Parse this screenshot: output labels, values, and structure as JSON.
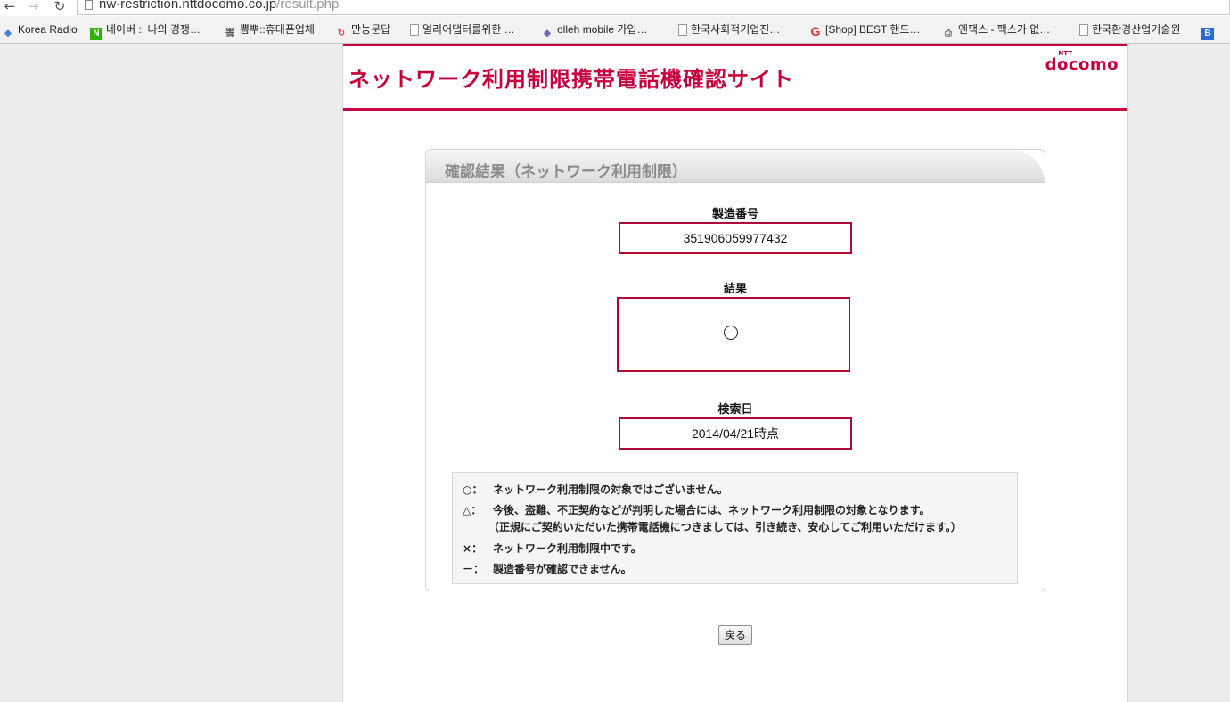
{
  "browser": {
    "url_host": "nw-restriction.nttdocomo.co.jp",
    "url_path": "/result.php",
    "bookmarks": [
      {
        "label": "Korea Radio",
        "icon": "radio-icon"
      },
      {
        "label": "네이버 :: 나의 경쟁…",
        "icon": "naver-icon"
      },
      {
        "label": "뽐뿌::휴대폰업체",
        "icon": "ppomppu-icon"
      },
      {
        "label": "만능문답",
        "icon": "swirl-icon"
      },
      {
        "label": "얼리어댑터를위한 …",
        "icon": "page-icon"
      },
      {
        "label": "olleh mobile 가입…",
        "icon": "diamond-icon"
      },
      {
        "label": "한국사회적기업진…",
        "icon": "page-icon"
      },
      {
        "label": "[Shop] BEST 핸드…",
        "icon": "shop-icon"
      },
      {
        "label": "엔팩스 - 팩스가 없…",
        "icon": "fax-icon"
      },
      {
        "label": "한국환경산업기술원",
        "icon": "page-icon"
      },
      {
        "label": "",
        "icon": "b-icon"
      }
    ]
  },
  "header": {
    "site_title": "ネットワーク利用制限携帯電話機確認サイト",
    "logo_ntt": "NTT",
    "logo_word": "docomo",
    "brand_color": "#c8003c"
  },
  "panel": {
    "title": "確認結果（ネットワーク利用制限）",
    "serial_label": "製造番号",
    "serial_value": "351906059977432",
    "result_label": "結果",
    "result_value": "○",
    "date_label": "検索日",
    "date_value": "2014/04/21時点"
  },
  "legend": {
    "circle_sym": "○",
    "circle_text": "ネットワーク利用制限の対象ではございません。",
    "triangle_sym": "△",
    "triangle_text": "今後、盗難、不正契約などが判明した場合には、ネットワーク利用制限の対象となります。",
    "triangle_sub": "（正規にご契約いただいた携帯電話機につきましては、引き続き、安心してご利用いただけます。）",
    "cross_sym": "×",
    "cross_text": "ネットワーク利用制限中です。",
    "dash_sym": "－",
    "dash_text": "製造番号が確認できません。",
    "separator": "："
  },
  "actions": {
    "back_label": "戻る"
  }
}
